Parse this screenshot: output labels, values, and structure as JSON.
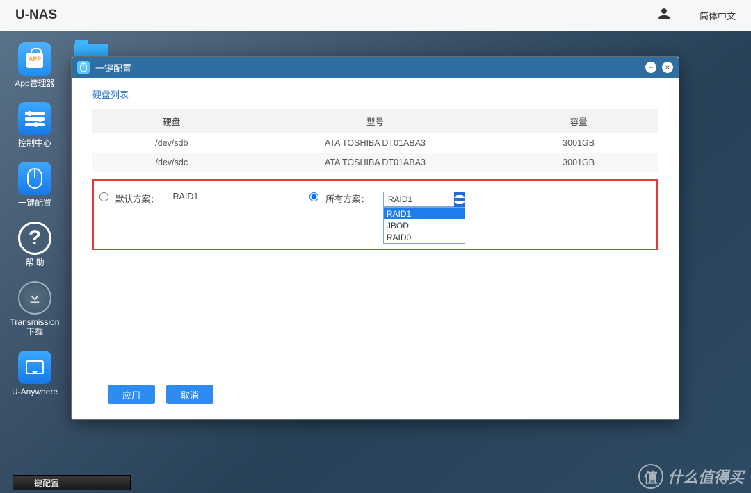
{
  "topbar": {
    "brand": "U-NAS",
    "language": "简体中文"
  },
  "dock": {
    "app_manager": "App管理器",
    "control_center": "控制中心",
    "one_click": "一键配置",
    "help": "帮 助",
    "transmission": "Transmission\n下载",
    "uanywhere": "U-Anywhere"
  },
  "taskbar": {
    "active": "一键配置"
  },
  "watermark": {
    "char": "值",
    "text": "什么值得买"
  },
  "window": {
    "title": "一键配置",
    "section_title": "硬盘列表",
    "columns": {
      "disk": "硬盘",
      "model": "型号",
      "capacity": "容量"
    },
    "rows": [
      {
        "disk": "/dev/sdb",
        "model": "ATA TOSHIBA DT01ABA3",
        "capacity": "3001GB"
      },
      {
        "disk": "/dev/sdc",
        "model": "ATA TOSHIBA DT01ABA3",
        "capacity": "3001GB"
      }
    ],
    "default_scheme_label": "默认方案：",
    "default_scheme_value": "RAID1",
    "all_scheme_label": "所有方案：",
    "select_value": "RAID1",
    "options": [
      "RAID1",
      "JBOD",
      "RAID0"
    ],
    "apply": "应用",
    "cancel": "取消"
  }
}
